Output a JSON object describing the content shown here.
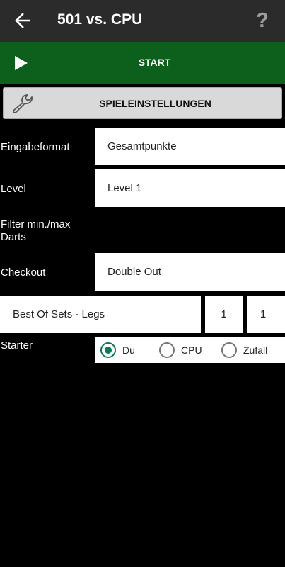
{
  "appbar": {
    "title": "501 vs. CPU",
    "back_icon": "arrow-left-icon",
    "help_symbol": "?"
  },
  "start": {
    "label": "START",
    "icon": "play-icon"
  },
  "settings": {
    "label": "SPIELEINSTELLUNGEN",
    "icon": "wrench-icon"
  },
  "form": {
    "input_format": {
      "label": "Eingabeformat",
      "value": "Gesamtpunkte"
    },
    "level": {
      "label": "Level",
      "value": "Level 1"
    },
    "filter": {
      "label_line1": "Filter min./max",
      "label_line2": "Darts"
    },
    "checkout": {
      "label": "Checkout",
      "value": "Double Out"
    },
    "best_of": {
      "label": "Best Of Sets - Legs",
      "sets": "1",
      "legs": "1"
    },
    "starter": {
      "label": "Starter",
      "options": [
        "Du",
        "CPU",
        "Zufall"
      ],
      "selected": "Du"
    }
  },
  "colors": {
    "appbar": "#2b2b2b",
    "start_bar": "#0d5f1c",
    "radio_accent": "#0b7a5a",
    "background": "#000000"
  }
}
